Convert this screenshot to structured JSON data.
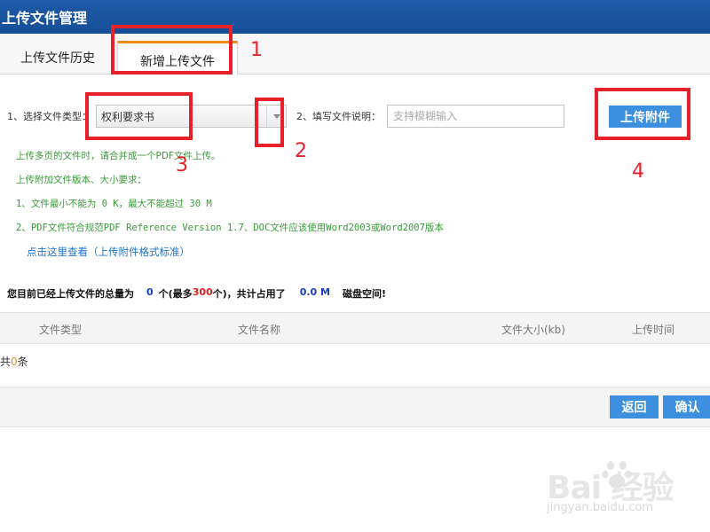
{
  "window": {
    "title": "上传文件管理"
  },
  "tabs": [
    {
      "label": "上传文件历史"
    },
    {
      "label": "新增上传文件",
      "active": true
    }
  ],
  "form": {
    "type_label": "1、选择文件类型：",
    "type_value": "权利要求书",
    "desc_label": "2、填写文件说明：",
    "desc_placeholder": "支持模糊输入",
    "desc_value": "",
    "upload_button": "上传附件"
  },
  "notes": [
    "上传多页的文件时，请合并成一个PDF文件上传。",
    "上传附加文件版本、大小要求：",
    "1、文件最小不能为 0 K，最大不能超过 30 M",
    "2、PDF文件符合规范PDF Reference Version 1.7、DOC文件应该使用Word2003或Word2007版本"
  ],
  "format_link": "点击这里查看（上传附件格式标准）",
  "summary": {
    "prefix": "您目前已经上传文件的总量为",
    "count": "0",
    "mid1": "个(最多",
    "max": "300",
    "mid2": "个)，共计占用了",
    "size": "0.0 M",
    "suffix": "磁盘空间!"
  },
  "table": {
    "columns": [
      "文件类型",
      "文件名称",
      "文件大小(kb)",
      "上传时间"
    ],
    "rows": []
  },
  "record_count": {
    "prefix": "共",
    "count": "0",
    "suffix": "条"
  },
  "buttons": {
    "back": "返回",
    "confirm": "确认"
  },
  "annotations": {
    "m1": "1",
    "m2": "2",
    "m3": "3",
    "m4": "4"
  },
  "watermark": {
    "brand": "Bai  经验",
    "site": "jingyan.baidu.com"
  },
  "colors": {
    "titlebar": "#1e5aa7",
    "accent_tab": "#f08a1b",
    "button": "#3d8fe0",
    "note_green": "#3a9a3a",
    "marker_red": "#e8202a"
  }
}
